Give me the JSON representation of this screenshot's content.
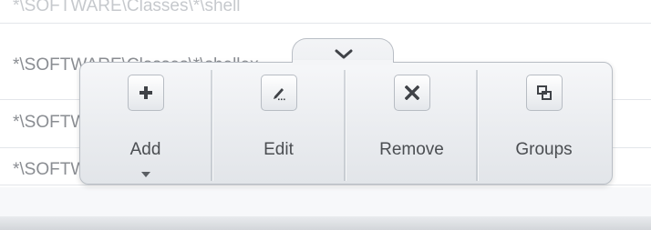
{
  "list": {
    "rows": [
      "*\\SOFTWARE\\Classes\\*\\shell",
      "*\\SOFTWARE\\Classes\\*\\shellex",
      "*\\SOFTWARE\\Classes\\Folder",
      "*\\SOFTWARE\\Classes\\Drive"
    ]
  },
  "toolbar": {
    "collapse_icon": "chevron-down-icon",
    "items": [
      {
        "label": "Add",
        "icon": "plus-icon",
        "has_dropdown": true
      },
      {
        "label": "Edit",
        "icon": "pencil-icon"
      },
      {
        "label": "Remove",
        "icon": "x-icon"
      },
      {
        "label": "Groups",
        "icon": "groups-icon"
      }
    ]
  },
  "colors": {
    "toolbar_bg": "#eceef1",
    "icon_dark": "#3f4247",
    "label_text": "#4b4e52"
  }
}
